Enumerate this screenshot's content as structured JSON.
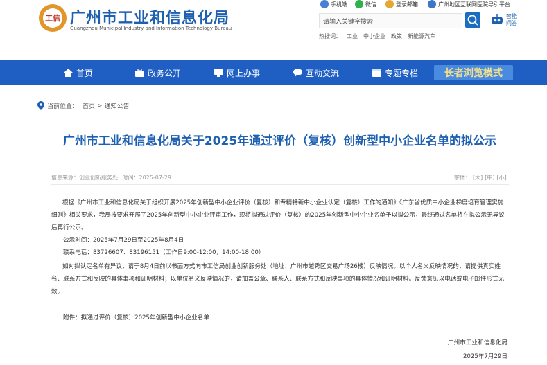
{
  "header": {
    "logo_text": "工信",
    "title": "广州市工业和信息化局",
    "subtitle": "Guangzhou Municipal Industry and Information Technology Bureau",
    "tools": [
      {
        "label": "手机端",
        "icon": "mobile-icon",
        "color": "#4a7fd6"
      },
      {
        "label": "微信",
        "icon": "wechat-icon",
        "color": "#2fb24c"
      },
      {
        "label": "登录邮箱",
        "icon": "mail-icon",
        "color": "#e8a735"
      },
      {
        "label": "广州地区互联网医院导引平台",
        "icon": "hospital-icon",
        "color": "#3a77c9"
      }
    ],
    "search_placeholder": "请输入关键字搜索",
    "robot_label": "智能问答",
    "hot_label": "热搜词：",
    "hot_words": [
      "工业",
      "中小企业",
      "政策",
      "新能源汽车"
    ]
  },
  "nav": {
    "items": [
      {
        "label": "首页",
        "icon": "home-icon"
      },
      {
        "label": "政务公开",
        "icon": "briefcase-icon"
      },
      {
        "label": "网上办事",
        "icon": "monitor-icon"
      },
      {
        "label": "互动交流",
        "icon": "chat-icon"
      },
      {
        "label": "专题专栏",
        "icon": "calendar-icon"
      }
    ],
    "elder_mode": "长者浏览模式"
  },
  "breadcrumb": {
    "label": "当前位置：",
    "items": [
      "首页",
      "通知公告"
    ],
    "separator": ">"
  },
  "article": {
    "title": "广州市工业和信息化局关于2025年通过评价（复核）创新型中小企业名单的拟公示",
    "source": "信息来源：创业创新服务处",
    "time": "时间：2025-07-29",
    "font_label": "字体：",
    "font_sizes": [
      "[大]",
      "[中]",
      "[小]"
    ],
    "para1": "根据《广州市工业和信息化局关于组织开展2025年创新型中小企业评价（复核）和专精特新中小企业认定（复核）工作的通知》《广东省优质中小企业梯度培育管理实施细则》相关要求，我局按要求开展了2025年创新型中小企业评审工作，现将拟通过评价（复核）的2025年创新型中小企业名单予以拟公示，最终通过名单将在拟公示无异议后再行公示。",
    "period": "公示时间：2025年7月29日至2025年8月4日",
    "phone": "联系电话：83726607、83196151（工作日9:00-12:00，14:00-18:00）",
    "para4": "如对拟认定名单有异议，请于8月4日前以书面方式向市工信局创业创新服务处（地址：广州市越秀区交易广场26楼）反映情况。以个人名义反映情况的，请提供真实姓名、联系方式和反映的具体事项和证明材料；以单位名义反映情况的，请加盖公章、联系人、联系方式和反映事项的具体情况和证明材料。反馈意见以电话或电子邮件形式无效。",
    "attachment": "附件：拟通过评价（复核）2025年创新型中小企业名单",
    "signature": "广州市工业和信息化局",
    "date": "2025年7月29日"
  },
  "colors": {
    "brand_blue": "#1d5fb0",
    "nav_bg": "#1f5fc4",
    "elder_bg": "#4a8be0",
    "elder_text": "#f4e08a"
  }
}
